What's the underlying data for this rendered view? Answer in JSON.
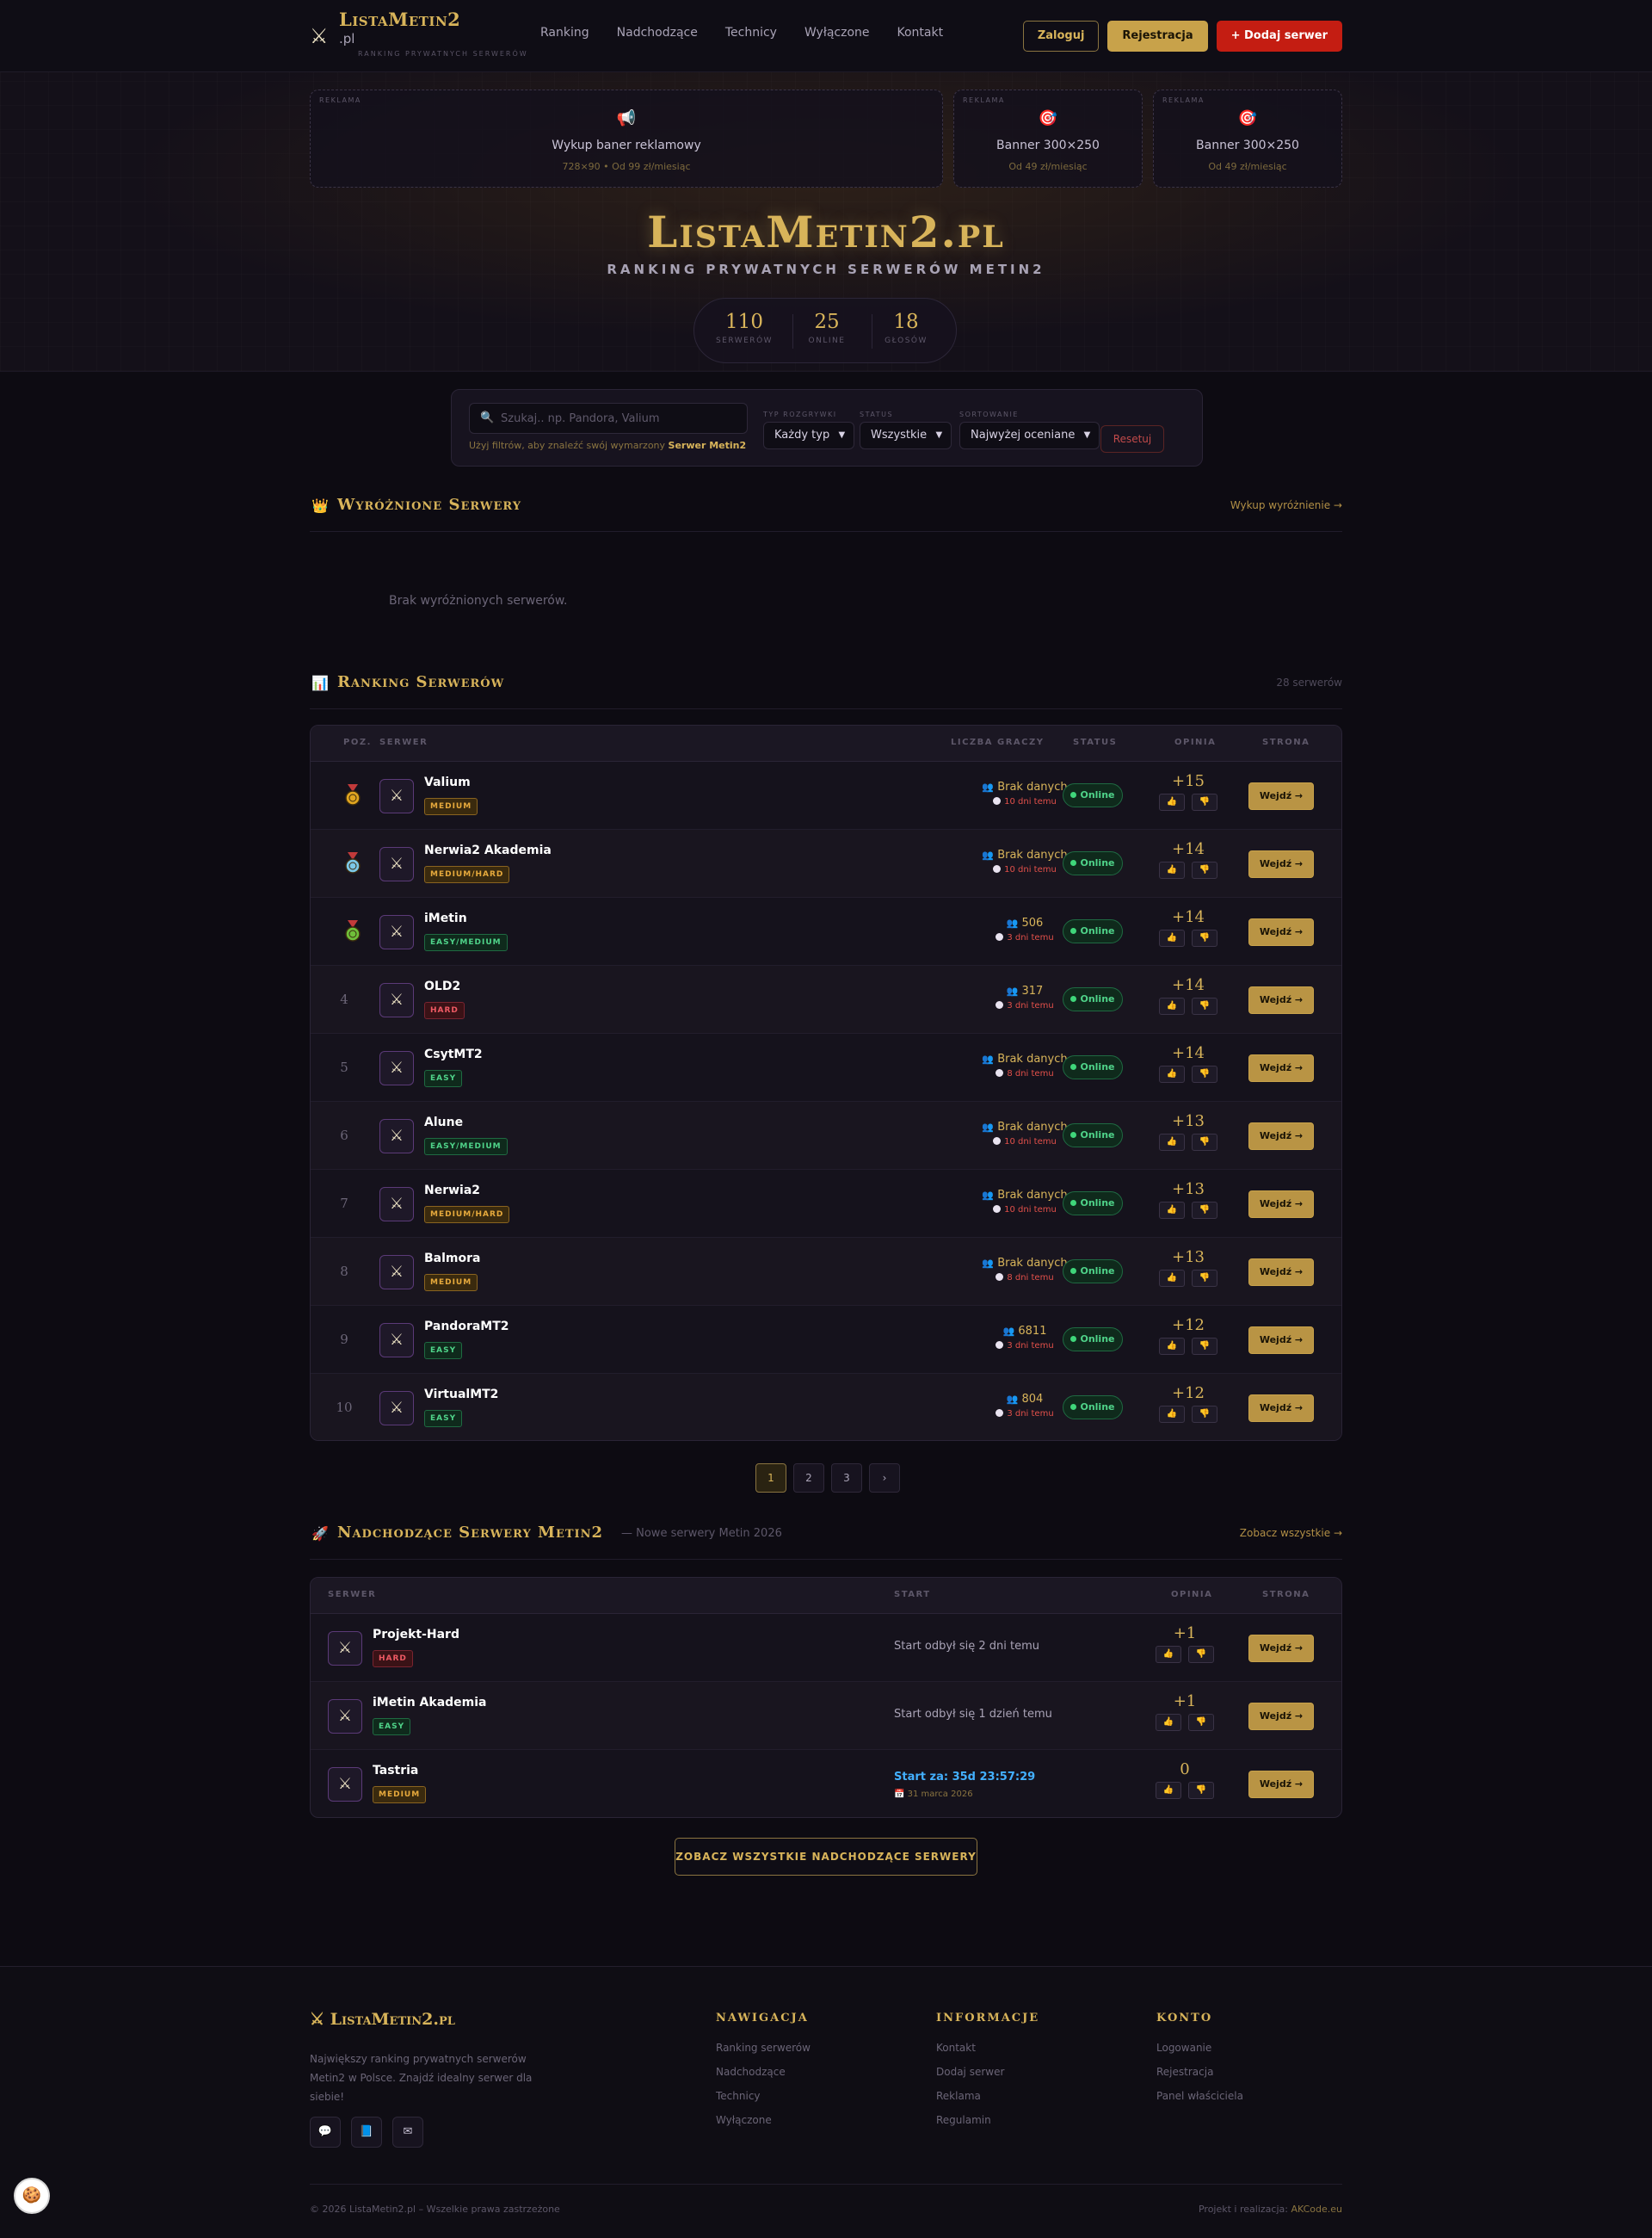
{
  "header": {
    "logo_title": "ListaMetin2",
    "logo_suffix": ".pl",
    "logo_tagline": "Ranking prywatnych serwerów",
    "nav": [
      "Ranking",
      "Nadchodzące",
      "Technicy",
      "Wyłączone",
      "Kontakt"
    ],
    "login": "Zaloguj",
    "register": "Rejestracja",
    "add_server": "+ Dodaj serwer"
  },
  "ads": [
    {
      "label": "REKLAMA",
      "icon": "megaphone-icon",
      "title": "Wykup baner reklamowy",
      "sub": "728×90 • Od 99 zł/miesiąc"
    },
    {
      "label": "REKLAMA",
      "icon": "target-icon",
      "title": "Banner 300×250",
      "sub": "Od 49 zł/miesiąc"
    },
    {
      "label": "REKLAMA",
      "icon": "target-icon",
      "title": "Banner 300×250",
      "sub": "Od 49 zł/miesiąc"
    }
  ],
  "hero": {
    "title": "ListaMetin2.pl",
    "subtitle": "RANKING PRYWATNYCH SERWERÓW METIN2",
    "stats": [
      {
        "value": "110",
        "label": "SERWERÓW"
      },
      {
        "value": "25",
        "label": "ONLINE"
      },
      {
        "value": "18",
        "label": "GŁOSÓW"
      }
    ]
  },
  "filters": {
    "search_placeholder": "Szukaj.. np. Pandora, Valium",
    "hint_prefix": "Użyj filtrów, aby znaleźć swój wymarzony ",
    "hint_bold": "Serwer Metin2",
    "type_label": "TYP ROZGRYWKI",
    "type_value": "Każdy typ",
    "status_label": "STATUS",
    "status_value": "Wszystkie",
    "sort_label": "SORTOWANIE",
    "sort_value": "Najwyżej oceniane",
    "reset": "Resetuj"
  },
  "featured": {
    "title": "Wyróżnione Serwery",
    "link": "Wykup wyróżnienie →",
    "empty": "Brak wyróżnionych serwerów."
  },
  "ranking": {
    "title": "Ranking Serwerów",
    "meta": "28 serwerów",
    "columns": [
      "POZ.",
      "SERWER",
      "LICZBA GRACZY",
      "STATUS",
      "OPINIA",
      "STRONA"
    ],
    "enter_label": "Wejdź →",
    "rows": [
      {
        "pos": "1",
        "medal": "gold",
        "name": "Valium",
        "badge": "MEDIUM",
        "badge_type": "medium",
        "players": "Brak danych",
        "time": "10 dni temu",
        "status": "Online",
        "score": "+15"
      },
      {
        "pos": "2",
        "medal": "silver",
        "name": "Nerwia2 Akademia",
        "badge": "MEDIUM/HARD",
        "badge_type": "medium",
        "players": "Brak danych",
        "time": "10 dni temu",
        "status": "Online",
        "score": "+14"
      },
      {
        "pos": "3",
        "medal": "bronze",
        "name": "iMetin",
        "badge": "EASY/MEDIUM",
        "badge_type": "easy",
        "players": "506",
        "time": "3 dni temu",
        "status": "Online",
        "score": "+14"
      },
      {
        "pos": "4",
        "medal": "",
        "name": "OLD2",
        "badge": "HARD",
        "badge_type": "hard",
        "players": "317",
        "time": "3 dni temu",
        "status": "Online",
        "score": "+14"
      },
      {
        "pos": "5",
        "medal": "",
        "name": "CsytMT2",
        "badge": "EASY",
        "badge_type": "easy",
        "players": "Brak danych",
        "time": "8 dni temu",
        "status": "Online",
        "score": "+14"
      },
      {
        "pos": "6",
        "medal": "",
        "name": "Alune",
        "badge": "EASY/MEDIUM",
        "badge_type": "easy",
        "players": "Brak danych",
        "time": "10 dni temu",
        "status": "Online",
        "score": "+13"
      },
      {
        "pos": "7",
        "medal": "",
        "name": "Nerwia2",
        "badge": "MEDIUM/HARD",
        "badge_type": "medium",
        "players": "Brak danych",
        "time": "10 dni temu",
        "status": "Online",
        "score": "+13"
      },
      {
        "pos": "8",
        "medal": "",
        "name": "Balmora",
        "badge": "MEDIUM",
        "badge_type": "medium",
        "players": "Brak danych",
        "time": "8 dni temu",
        "status": "Online",
        "score": "+13"
      },
      {
        "pos": "9",
        "medal": "",
        "name": "PandoraMT2",
        "badge": "EASY",
        "badge_type": "easy",
        "players": "6811",
        "time": "3 dni temu",
        "status": "Online",
        "score": "+12"
      },
      {
        "pos": "10",
        "medal": "",
        "name": "VirtualMT2",
        "badge": "EASY",
        "badge_type": "easy",
        "players": "804",
        "time": "3 dni temu",
        "status": "Online",
        "score": "+12"
      }
    ]
  },
  "pagination": [
    "1",
    "2",
    "3",
    "›"
  ],
  "upcoming": {
    "title": "Nadchodzące Serwery Metin2",
    "subtitle": "— Nowe serwery Metin 2026",
    "link": "Zobacz wszystkie →",
    "columns": [
      "SERWER",
      "START",
      "OPINIA",
      "STRONA"
    ],
    "rows": [
      {
        "name": "Projekt-Hard",
        "badge": "HARD",
        "badge_type": "hard",
        "start": "Start odbył się 2 dni temu",
        "countdown": "",
        "date": "",
        "score": "+1"
      },
      {
        "name": "iMetin Akademia",
        "badge": "EASY",
        "badge_type": "easy",
        "start": "Start odbył się 1 dzień temu",
        "countdown": "",
        "date": "",
        "score": "+1"
      },
      {
        "name": "Tastria",
        "badge": "MEDIUM",
        "badge_type": "medium",
        "start": "",
        "countdown": "Start za: 35d 23:57:29",
        "date": "31 marca 2026",
        "score": "0"
      }
    ],
    "see_all": "ZOBACZ WSZYSTKIE NADCHODZĄCE SERWERY"
  },
  "footer": {
    "logo": "⚔ ListaMetin2.pl",
    "desc": "Największy ranking prywatnych serwerów Metin2 w Polsce. Znajdź idealny serwer dla siebie!",
    "cols": [
      {
        "title": "NAWIGACJA",
        "links": [
          "Ranking serwerów",
          "Nadchodzące",
          "Technicy",
          "Wyłączone"
        ]
      },
      {
        "title": "INFORMACJE",
        "links": [
          "Kontakt",
          "Dodaj serwer",
          "Reklama",
          "Regulamin"
        ]
      },
      {
        "title": "KONTO",
        "links": [
          "Logowanie",
          "Rejestracja",
          "Panel właściciela"
        ]
      }
    ],
    "copyright": "© 2026 ListaMetin2.pl – Wszelkie prawa zastrzeżone",
    "credit_prefix": "Projekt i realizacja: ",
    "credit_name": "AKCode.eu"
  },
  "colors": {
    "gold": "#d8b45a",
    "red": "#c41d12",
    "online": "#4fd389",
    "countdown": "#43b0ff"
  }
}
